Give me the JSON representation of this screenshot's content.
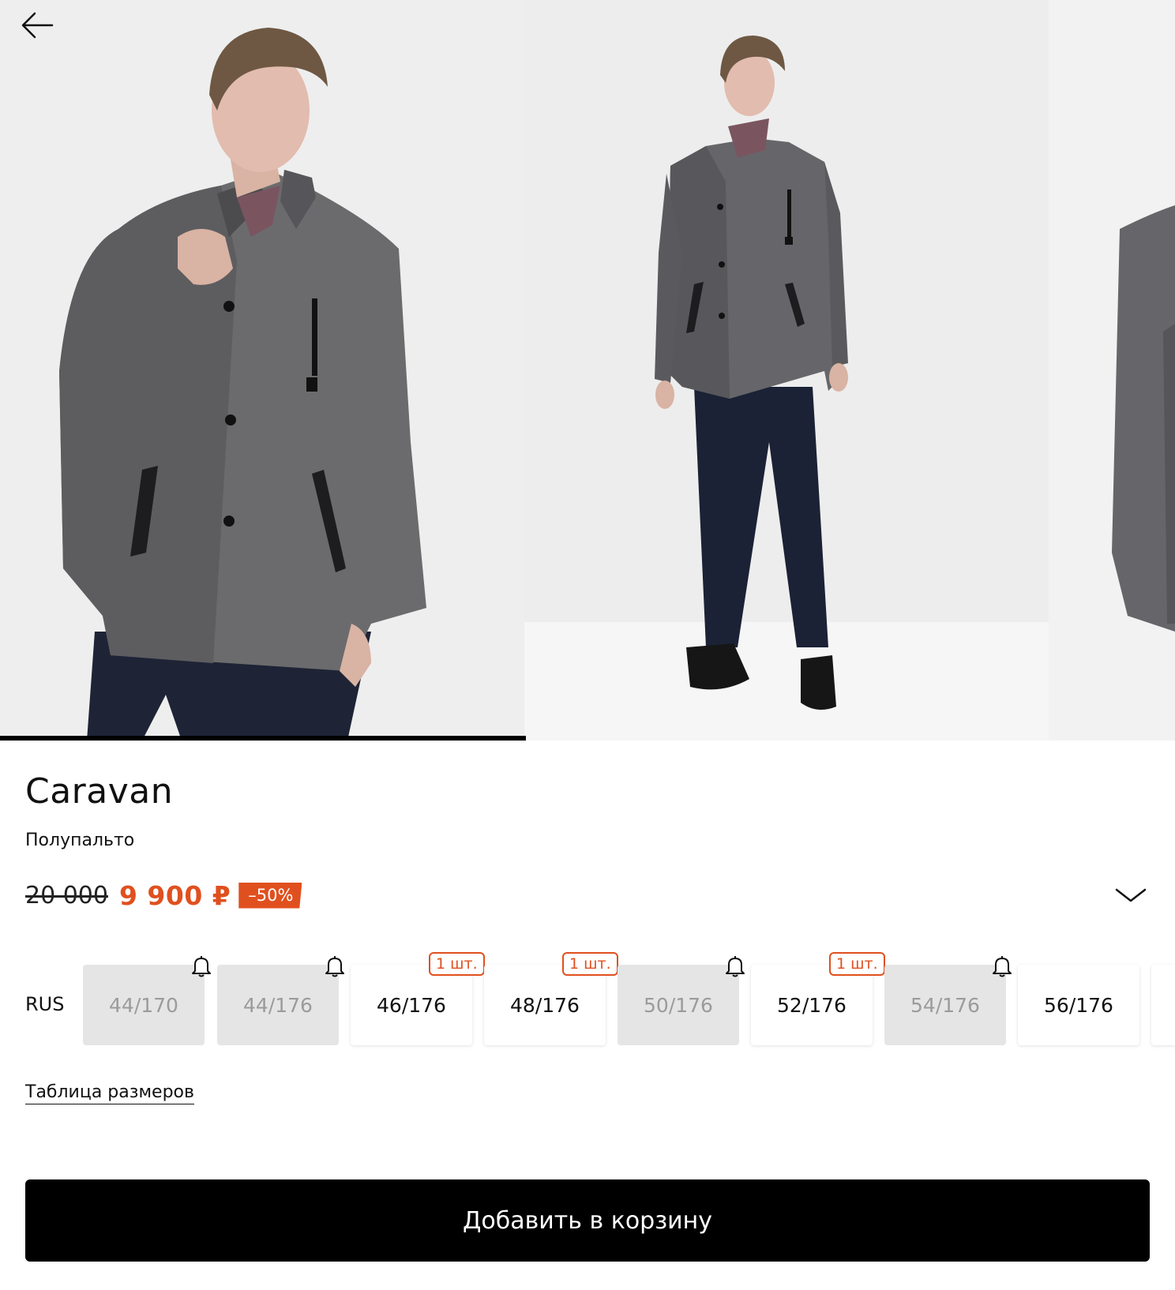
{
  "product": {
    "brand": "Caravan",
    "type": "Полупальто",
    "old_price": "20 000",
    "new_price": "9 900 ₽",
    "discount": "–50%"
  },
  "gallery": {
    "image_1": "photo of man in grey wool coat, close-up",
    "image_2": "photo of man in grey wool coat, full length",
    "image_3": "photo of coat, partially visible"
  },
  "sizes": {
    "system": "RUS",
    "items": [
      {
        "label": "44/170",
        "available": false,
        "badge": "bell"
      },
      {
        "label": "44/176",
        "available": false,
        "badge": "bell"
      },
      {
        "label": "46/176",
        "available": true,
        "badge": "1 шт."
      },
      {
        "label": "48/176",
        "available": true,
        "badge": "1 шт."
      },
      {
        "label": "50/176",
        "available": false,
        "badge": "bell"
      },
      {
        "label": "52/176",
        "available": true,
        "badge": "1 шт."
      },
      {
        "label": "54/176",
        "available": false,
        "badge": "bell"
      },
      {
        "label": "56/176",
        "available": true,
        "badge": null
      }
    ]
  },
  "links": {
    "size_table": "Таблица размеров"
  },
  "actions": {
    "add_to_cart": "Добавить в корзину"
  },
  "colors": {
    "accent": "#e0501f",
    "button": "#000000",
    "unavailable_bg": "#e5e5e5"
  },
  "icons": {
    "back": "arrow-left-icon",
    "expand": "chevron-down-icon",
    "notify": "bell-icon"
  }
}
